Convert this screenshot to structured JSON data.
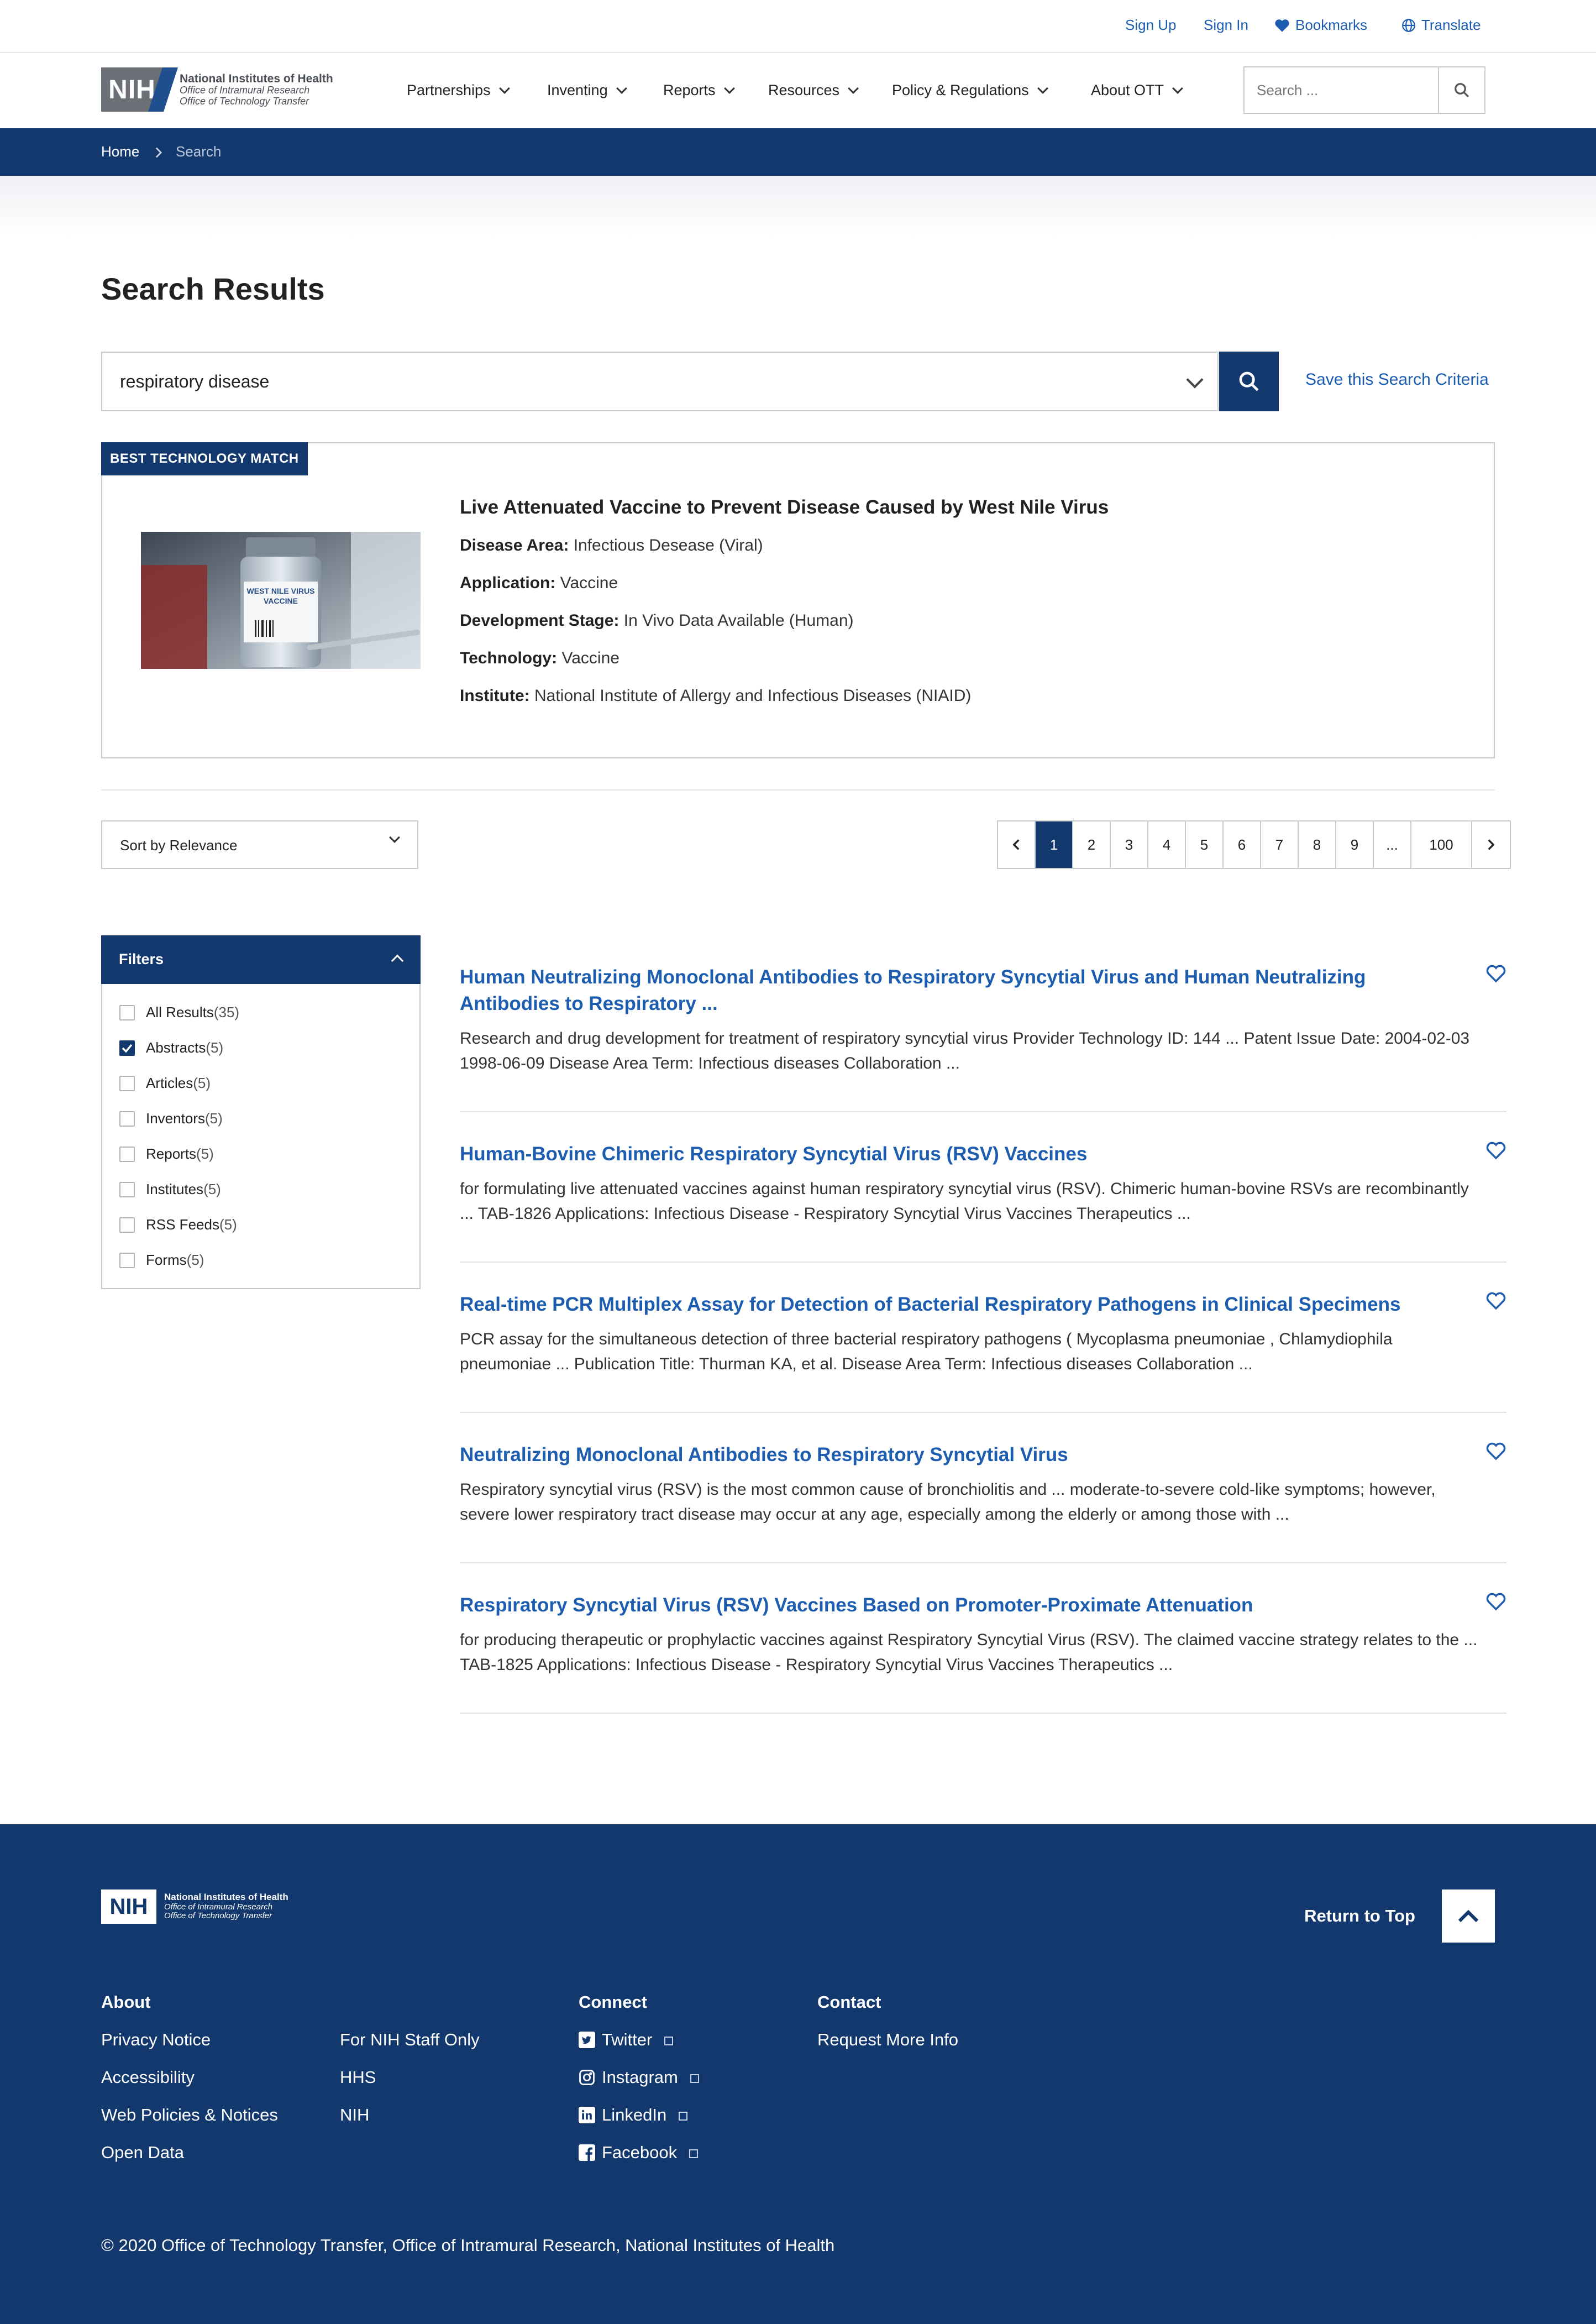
{
  "utility": {
    "sign_up": "Sign Up",
    "sign_in": "Sign In",
    "bookmarks": "Bookmarks",
    "translate": "Translate"
  },
  "logo": {
    "mark": "NIH",
    "line1": "National Institutes of Health",
    "line2": "Office of Intramural Research",
    "line3": "Office of Technology Transfer"
  },
  "nav": [
    "Partnerships",
    "Inventing",
    "Reports",
    "Resources",
    "Policy & Regulations",
    "About OTT"
  ],
  "header_search": {
    "placeholder": "Search ..."
  },
  "breadcrumb": {
    "home": "Home",
    "current": "Search"
  },
  "page_title": "Search Results",
  "search": {
    "value": "respiratory disease",
    "save_label": "Save this Search Criteria"
  },
  "best_match": {
    "badge": "BEST TECHNOLOGY MATCH",
    "title": "Live Attenuated Vaccine to Prevent Disease Caused by West Nile Virus",
    "image_label_line1": "WEST NILE VIRUS",
    "image_label_line2": "VACCINE",
    "fields": [
      {
        "label": "Disease Area:",
        "value": "Infectious Desease (Viral)"
      },
      {
        "label": "Application:",
        "value": "Vaccine"
      },
      {
        "label": "Development Stage:",
        "value": "In Vivo Data Available (Human)"
      },
      {
        "label": "Technology:",
        "value": "Vaccine"
      },
      {
        "label": "Institute:",
        "value": "National Institute of Allergy and Infectious Diseases (NIAID)"
      }
    ]
  },
  "sort": {
    "label": "Sort by Relevance"
  },
  "pagination": {
    "pages": [
      "1",
      "2",
      "3",
      "4",
      "5",
      "6",
      "7",
      "8",
      "9",
      "...",
      "100"
    ],
    "current": "1"
  },
  "filters": {
    "title": "Filters",
    "items": [
      {
        "label": "All Results",
        "count": "(35)",
        "checked": false
      },
      {
        "label": "Abstracts",
        "count": "(5)",
        "checked": true
      },
      {
        "label": "Articles",
        "count": "(5)",
        "checked": false
      },
      {
        "label": "Inventors",
        "count": "(5)",
        "checked": false
      },
      {
        "label": "Reports",
        "count": "(5)",
        "checked": false
      },
      {
        "label": "Institutes",
        "count": "(5)",
        "checked": false
      },
      {
        "label": "RSS Feeds",
        "count": "(5)",
        "checked": false
      },
      {
        "label": "Forms",
        "count": "(5)",
        "checked": false
      }
    ]
  },
  "results": [
    {
      "title": "Human Neutralizing Monoclonal Antibodies to Respiratory Syncytial Virus and Human Neutralizing Antibodies to Respiratory ...",
      "desc": "Research and drug development for treatment of respiratory syncytial virus Provider Technology ID:  144 ... Patent Issue Date: 2004-02-03 1998-06-09 Disease Area Term:  Infectious diseases Collaboration ..."
    },
    {
      "title": "Human-Bovine Chimeric Respiratory Syncytial Virus (RSV) Vaccines",
      "desc": "for formulating live attenuated vaccines against human respiratory syncytial virus (RSV). Chimeric human-bovine RSVs are recombinantly ... TAB-1826 Applications:  Infectious Disease - Respiratory Syncytial Virus Vaccines Therapeutics ..."
    },
    {
      "title": "Real-time PCR Multiplex Assay for Detection of Bacterial Respiratory Pathogens in Clinical Specimens",
      "desc": "PCR assay for the simultaneous detection of three bacterial respiratory pathogens ( Mycoplasma pneumoniae , Chlamydiophila pneumoniae ... Publication Title:  Thurman KA, et al. Disease Area Term:  Infectious diseases Collaboration ..."
    },
    {
      "title": "Neutralizing Monoclonal Antibodies to Respiratory Syncytial Virus",
      "desc": "Respiratory syncytial virus (RSV) is the most common cause of bronchiolitis and ... moderate-to-severe cold-like symptoms; however, severe lower respiratory tract disease may occur at any age, especially among the elderly or among those with ..."
    },
    {
      "title": "Respiratory Syncytial Virus (RSV) Vaccines Based on Promoter-Proximate Attenuation",
      "desc": "for producing therapeutic or prophylactic vaccines against Respiratory Syncytial Virus (RSV). The claimed vaccine strategy relates to the ... TAB-1825 Applications:  Infectious Disease - Respiratory Syncytial Virus Vaccines Therapeutics ..."
    }
  ],
  "footer": {
    "return_to_top": "Return to Top",
    "about_head": "About",
    "about_links": [
      "Privacy Notice",
      "Accessibility",
      "Web Policies & Notices",
      "Open Data"
    ],
    "more_links": [
      "For NIH Staff Only",
      "HHS",
      "NIH"
    ],
    "connect_head": "Connect",
    "connect_links": [
      "Twitter",
      "Instagram",
      "LinkedIn",
      "Facebook"
    ],
    "contact_head": "Contact",
    "contact_links": [
      "Request More Info"
    ],
    "copyright": "© 2020 Office of Technology Transfer, Office of Intramural Research, National Institutes of Health"
  },
  "colors": {
    "navy": "#12386e",
    "link_blue": "#1c5db0",
    "border": "#c8cbd0"
  }
}
